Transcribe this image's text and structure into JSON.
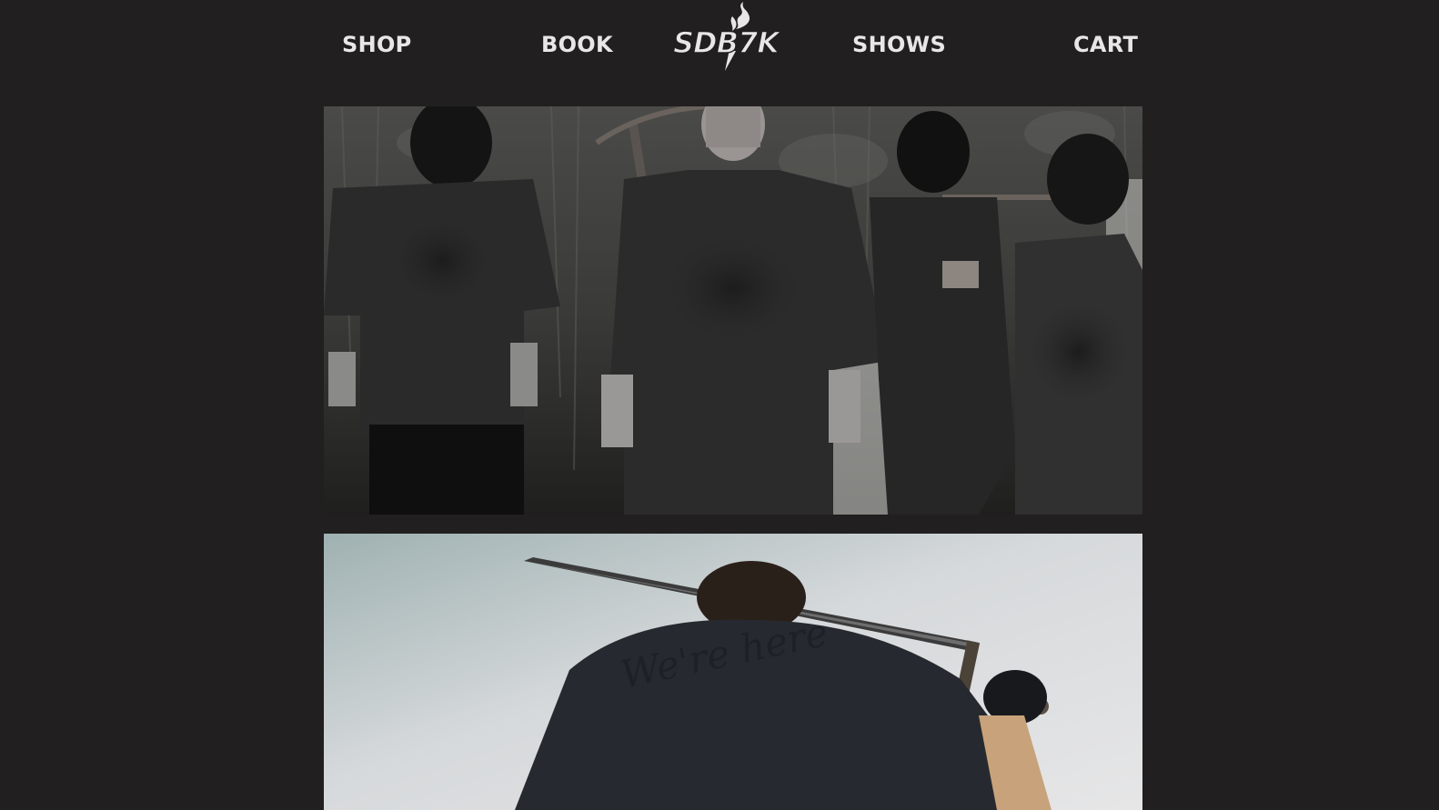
{
  "nav": {
    "shop": "SHOP",
    "book": "BOOK",
    "shows": "SHOWS",
    "cart": "CART"
  },
  "logo": {
    "text": "SDB7K"
  },
  "hero_2": {
    "shirt_text": "We're here"
  },
  "colors": {
    "background": "#211f20",
    "nav_text": "#e9e6e7"
  }
}
